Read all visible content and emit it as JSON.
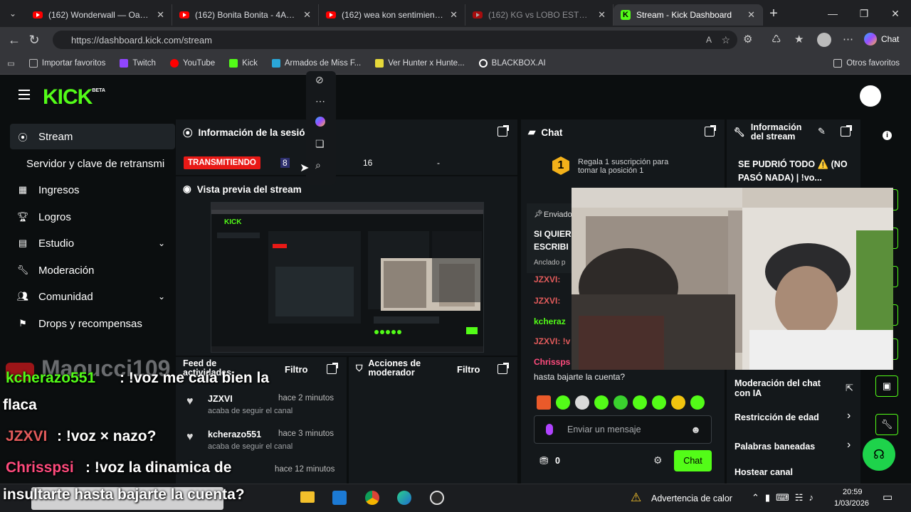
{
  "browser": {
    "tabs": [
      {
        "title": "(162) Wonderwall — Oasis || Su",
        "icon": "youtube-icon"
      },
      {
        "title": "(162) Bonita Bonita - 4AMTapes",
        "icon": "youtube-icon"
      },
      {
        "title": "(162) wea kon sentimiento : Rk",
        "icon": "youtube-icon"
      },
      {
        "title": "(162) KG vs LOBO ESTEPARIO | E",
        "icon": "youtube-icon"
      },
      {
        "title": "Stream - Kick Dashboard",
        "icon": "kick-icon"
      }
    ],
    "url": "https://dashboard.kick.com/stream",
    "chat_label": "Chat",
    "bookmarks": [
      "Importar favoritos",
      "Twitch",
      "YouTube",
      "Kick",
      "Armados de Miss F...",
      "Ver Hunter x Hunte...",
      "BLACKBOX.AI"
    ],
    "other_bookmarks": "Otros favoritos"
  },
  "sidebar": {
    "items": [
      {
        "label": "Stream",
        "icon": "broadcast-icon"
      },
      {
        "label": "Servidor y clave de retransmi",
        "icon": ""
      },
      {
        "label": "Ingresos",
        "icon": "chart-icon"
      },
      {
        "label": "Logros",
        "icon": "trophy-icon"
      },
      {
        "label": "Estudio",
        "icon": "grid-icon"
      },
      {
        "label": "Moderación",
        "icon": "wrench-icon"
      },
      {
        "label": "Comunidad",
        "icon": "people-icon"
      },
      {
        "label": "Drops y recompensas",
        "icon": "drops-icon"
      }
    ]
  },
  "session": {
    "title": "Información de la sesió",
    "status": "TRANSMITIENDO",
    "viewers": "8",
    "followers": "16",
    "dash": "-"
  },
  "preview": {
    "title": "Vista previa del stream"
  },
  "activity": {
    "title": "Feed de actividades",
    "filter": "Filtro",
    "items": [
      {
        "user": "JZXVI",
        "text": "acaba de seguir el canal",
        "time": "hace 2 minutos"
      },
      {
        "user": "kcherazo551",
        "text": "acaba de seguir el canal",
        "time": "hace 3 minutos"
      },
      {
        "user": "",
        "text": "",
        "time": "hace 12 minutos"
      }
    ]
  },
  "modactions": {
    "title": "Acciones de moderador",
    "filter": "Filtro"
  },
  "chat": {
    "title": "Chat",
    "gift_text": "Regala 1 suscripción para tomar la posición 1",
    "gift_rank": "1",
    "pinned_by": "Enviado",
    "pinned_text_1": "SI QUIER",
    "pinned_text_2": "ESCRIBI",
    "pinned_label": "Anclado p",
    "messages": [
      {
        "user": "JZXVI:",
        "color": "#e25b5b"
      },
      {
        "user": "JZXVI:",
        "color": "#e25b5b"
      },
      {
        "user": "kcheraz",
        "color": "#53fc18"
      },
      {
        "user": "JZXVI: !v",
        "color": "#e25b5b"
      },
      {
        "user": "Chrissps",
        "color": "#ff4b7d"
      }
    ],
    "last_line": "hasta bajarte la cuenta?",
    "input_placeholder": "Enviar un mensaje",
    "points": "0",
    "send": "Chat"
  },
  "streaminfo": {
    "title": "Información del stream",
    "stream_title": "SE PUDRIÓ TODO ⚠️ (NO PASÓ NADA) | !vo...",
    "options": [
      "Moderación del chat con IA",
      "Restricción de edad",
      "Palabras baneadas",
      "Hostear canal"
    ]
  },
  "overlay": {
    "streamer": "Maoucci109",
    "lines": [
      {
        "user": "kcherazo551",
        "text": ": !voz me caía bien la",
        "cont": "flaca",
        "color": "#53fc18"
      },
      {
        "user": "JZXVI",
        "text": ": !voz × nazo?",
        "cont": "",
        "color": "#e25b5b"
      },
      {
        "user": "Chrisspsi",
        "text": ": !voz la dinamica de",
        "cont": "insultarte hasta bajarte la cuenta?",
        "color": "#ff4b7d"
      }
    ]
  },
  "taskbar": {
    "warning": "Advertencia de calor",
    "time": "20:59",
    "date": "1/03/2026"
  }
}
